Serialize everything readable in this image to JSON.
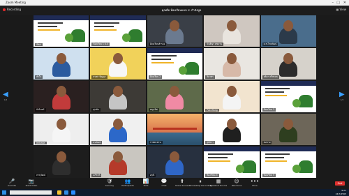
{
  "window": {
    "title": "Zoom Meeting"
  },
  "topbar": {
    "recording": "Recording",
    "speaker": "คุณคือ ห้องเรียนแบบ ป. กำลังพูด",
    "view": "View"
  },
  "nav": {
    "left_arrow": "◀",
    "right_arrow": "▶",
    "left_page": "1/2",
    "right_page": "1/2"
  },
  "tiles": [
    {
      "name": "iPad",
      "kind": "slide"
    },
    {
      "name": "ห้องเรียน 1 ป.4",
      "kind": "slide"
    },
    {
      "name": "ห้องเรียนสำรอง",
      "kind": "video",
      "bg": "#3a3f47",
      "shirt": "#6b7a8f"
    },
    {
      "name": "นันธิญา สุขบาน",
      "kind": "video",
      "bg": "#cfc7c0",
      "shirt": "#e9e4de"
    },
    {
      "name": "ด.ช.ไชยวัฒน์",
      "kind": "video",
      "bg": "#4a6d8c",
      "shirt": "#2b3a4a"
    },
    {
      "name": "หัวใจ",
      "kind": "video",
      "bg": "#cfe0ef",
      "shirt": "#2b5b9f"
    },
    {
      "name": "ธนพร ปัญญา",
      "kind": "video",
      "bg": "#f1d25a",
      "shirt": "#f7f7f7"
    },
    {
      "name": "ห้องเรียน 2",
      "kind": "slide"
    },
    {
      "name": "ธิดาพร",
      "kind": "video",
      "bg": "#e9e6e1",
      "shirt": "#d7b9a8"
    },
    {
      "name": "ลลิตา ศรีพรหม",
      "kind": "video",
      "bg": "#d6d2cb",
      "shirt": "#2c2c2c"
    },
    {
      "name": "จักรินทร์",
      "kind": "video",
      "bg": "#2a2020",
      "shirt": "#c23b3b"
    },
    {
      "name": "ศุภชัย",
      "kind": "video",
      "bg": "#3d3a36",
      "shirt": "#c5c5c5"
    },
    {
      "name": "ชญานิศ",
      "kind": "video",
      "bg": "#5e6a4a",
      "shirt": "#f08aa4"
    },
    {
      "name": "Pok Wang",
      "kind": "video",
      "bg": "#f2e4cf",
      "shirt": "#f4f4f4"
    },
    {
      "name": "ห้องเรียน 3",
      "kind": "slide"
    },
    {
      "name": "Jedsada",
      "kind": "video",
      "bg": "#eeeeee",
      "shirt": "#f5f5f5"
    },
    {
      "name": "ธนวัฒน์",
      "kind": "video",
      "bg": "#f0f0f0",
      "shirt": "#2c68c9"
    },
    {
      "name": "ภาพสะพาน",
      "kind": "bridge"
    },
    {
      "name": "สุพัตรา",
      "kind": "video",
      "bg": "#ffffff",
      "shirt": "#1f1f1f"
    },
    {
      "name": "สมชาย",
      "kind": "video",
      "bg": "#6d6659",
      "shirt": "#2e3e1f"
    },
    {
      "name": "ภานุวัฒน์",
      "kind": "video",
      "bg": "#1d1d1d",
      "shirt": "#2e2e2e"
    },
    {
      "name": "อภิชาติ",
      "kind": "video",
      "bg": "#c9c6c0",
      "shirt": "#b53a2a"
    },
    {
      "name": "อรุณี",
      "kind": "video",
      "bg": "#27303f",
      "shirt": "#2f66c6"
    },
    {
      "name": "ห้องเรียน 4",
      "kind": "slide"
    },
    {
      "name": "ห้องเรียน 5",
      "kind": "slide"
    }
  ],
  "toolbar": {
    "left": [
      {
        "icon": "🎤",
        "label": "Unmute"
      },
      {
        "icon": "📷",
        "label": "Start Video"
      }
    ],
    "center": [
      {
        "icon": "🛡",
        "label": "Security"
      },
      {
        "icon": "👥",
        "label": "Participants"
      },
      {
        "icon": "📊",
        "label": "Polls"
      },
      {
        "icon": "💬",
        "label": "Chat"
      },
      {
        "icon": "⬆",
        "label": "Share Screen"
      },
      {
        "icon": "⏸",
        "label": "Pause/Stop Recording"
      },
      {
        "icon": "▦",
        "label": "Breakout Rooms"
      },
      {
        "icon": "☺",
        "label": "Reactions"
      },
      {
        "icon": "•••",
        "label": "More"
      }
    ],
    "end": "End"
  },
  "taskbar": {
    "time": "9:21",
    "date": "24/7/2565"
  }
}
